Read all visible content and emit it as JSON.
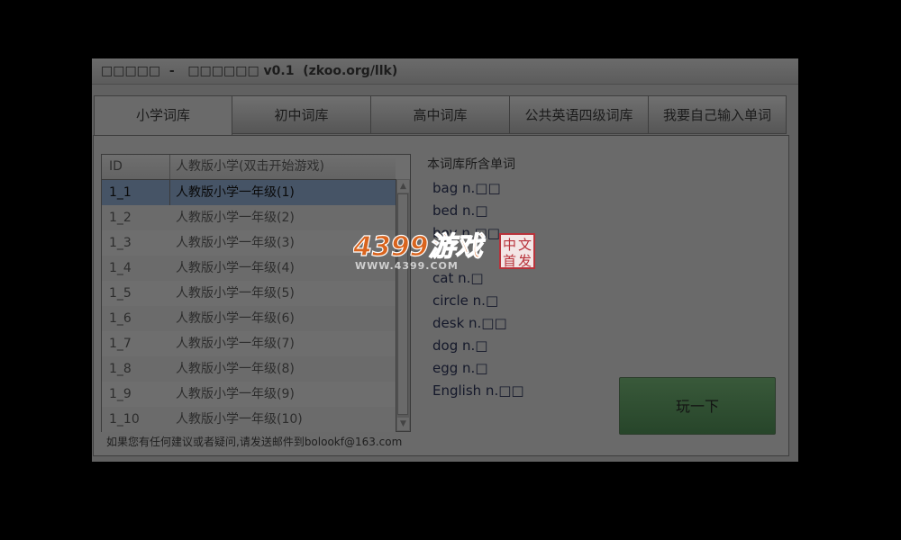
{
  "window": {
    "title": "□□□□□  -   □□□□□□ v0.1  (zkoo.org/llk)"
  },
  "tabs": [
    {
      "label": "小学词库",
      "active": true
    },
    {
      "label": "初中词库",
      "active": false
    },
    {
      "label": "高中词库",
      "active": false
    },
    {
      "label": "公共英语四级词库",
      "active": false
    },
    {
      "label": "我要自己输入单词",
      "active": false
    }
  ],
  "list": {
    "headers": [
      "ID",
      "人教版小学(双击开始游戏)"
    ],
    "rows": [
      {
        "id": "1_1",
        "name": "人教版小学一年级(1)",
        "selected": true
      },
      {
        "id": "1_2",
        "name": "人教版小学一年级(2)"
      },
      {
        "id": "1_3",
        "name": "人教版小学一年级(3)"
      },
      {
        "id": "1_4",
        "name": "人教版小学一年级(4)"
      },
      {
        "id": "1_5",
        "name": "人教版小学一年级(5)"
      },
      {
        "id": "1_6",
        "name": "人教版小学一年级(6)"
      },
      {
        "id": "1_7",
        "name": "人教版小学一年级(7)"
      },
      {
        "id": "1_8",
        "name": "人教版小学一年级(8)"
      },
      {
        "id": "1_9",
        "name": "人教版小学一年级(9)"
      },
      {
        "id": "1_10",
        "name": "人教版小学一年级(10)"
      }
    ],
    "scroll_up": "▲",
    "scroll_down": "▼"
  },
  "footer": "如果您有任何建议或者疑问,请发送邮件到bolookf@163.com",
  "words_panel": {
    "title": "本词库所含单词",
    "words": [
      "bag n.□□",
      "bed n.□",
      "boy n.□□",
      "",
      "cat n.□",
      "circle n.□",
      "desk n.□□",
      "dog n.□",
      "egg n.□",
      "English n.□□"
    ]
  },
  "play_button": "玩一下",
  "watermark": {
    "brand": "4399游戏",
    "url": "WWW.4399.COM",
    "stamp": [
      "中",
      "文",
      "首",
      "发"
    ]
  },
  "colors": {
    "play_button": "#2f4f31",
    "selected_row": "#465466",
    "background": "#000000"
  }
}
